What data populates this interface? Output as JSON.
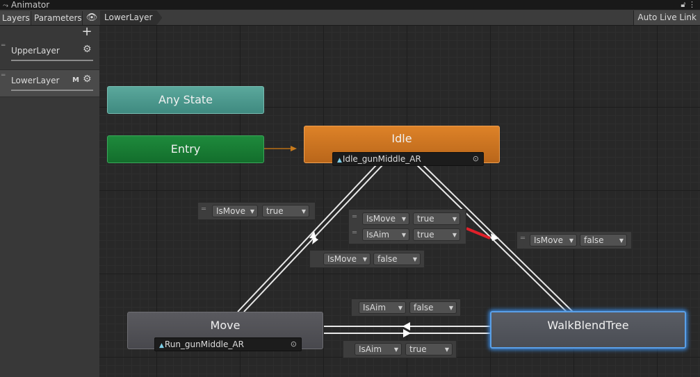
{
  "window": {
    "title": "Animator",
    "lock_icon": "lock-icon",
    "menu_icon": "kebab-menu-icon"
  },
  "toolbar": {
    "tab_layers": "Layers",
    "tab_parameters": "Parameters",
    "eye_icon": "eye-icon",
    "breadcrumb": "LowerLayer",
    "auto_live_link": "Auto Live Link"
  },
  "layers": {
    "add_icon": "plus-icon",
    "items": [
      {
        "name": "UpperLayer",
        "badge": ""
      },
      {
        "name": "LowerLayer",
        "badge": "M"
      }
    ]
  },
  "states": {
    "any": {
      "label": "Any State",
      "color": "#4f9d92"
    },
    "entry": {
      "label": "Entry",
      "color": "#19803a"
    },
    "idle": {
      "label": "Idle",
      "motion": "Idle_gunMiddle_AR",
      "color": "#cf7421"
    },
    "move": {
      "label": "Move",
      "motion": "Run_gunMiddle_AR",
      "color": "#505055"
    },
    "walk": {
      "label": "WalkBlendTree",
      "color": "#52555c",
      "selection_color": "#3a86d8"
    }
  },
  "transitions": {
    "idle_to_move": {
      "conditions": [
        {
          "param": "IsMove",
          "value": "true"
        }
      ]
    },
    "move_to_idle": {
      "conditions": [
        {
          "param": "IsMove",
          "value": "false"
        }
      ]
    },
    "idle_to_walk": {
      "conditions": [
        {
          "param": "IsMove",
          "value": "true"
        },
        {
          "param": "IsAim",
          "value": "true"
        }
      ]
    },
    "walk_to_idle": {
      "conditions": [
        {
          "param": "IsMove",
          "value": "false"
        }
      ]
    },
    "move_to_walk": {
      "conditions": [
        {
          "param": "IsAim",
          "value": "false"
        }
      ]
    },
    "walk_to_move": {
      "conditions": [
        {
          "param": "IsAim",
          "value": "true"
        }
      ]
    },
    "selected_color": "#e0202a"
  }
}
